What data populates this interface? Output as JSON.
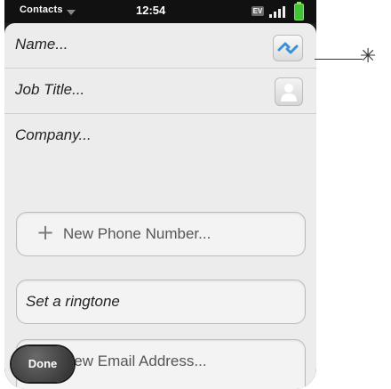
{
  "status_bar": {
    "app_name": "Contacts",
    "time": "12:54",
    "network": "EV"
  },
  "form": {
    "name_placeholder": "Name...",
    "job_title_placeholder": "Job Title...",
    "company_placeholder": "Company...",
    "new_phone_label": "New Phone Number...",
    "ringtone_label": "Set a ringtone",
    "new_email_label": "New Email Address..."
  },
  "done_button": {
    "label": "Done"
  },
  "icons": {
    "sync": "sync-link-icon",
    "photo": "contact-photo-icon",
    "plus": "plus-icon",
    "app_menu": "chevron-down-icon",
    "callout": "asterisk-callout-icon"
  },
  "colors": {
    "status_bar": "#111111",
    "card": "#ececec",
    "battery": "#46c23a",
    "sync_blue": "#3b8fd8"
  }
}
